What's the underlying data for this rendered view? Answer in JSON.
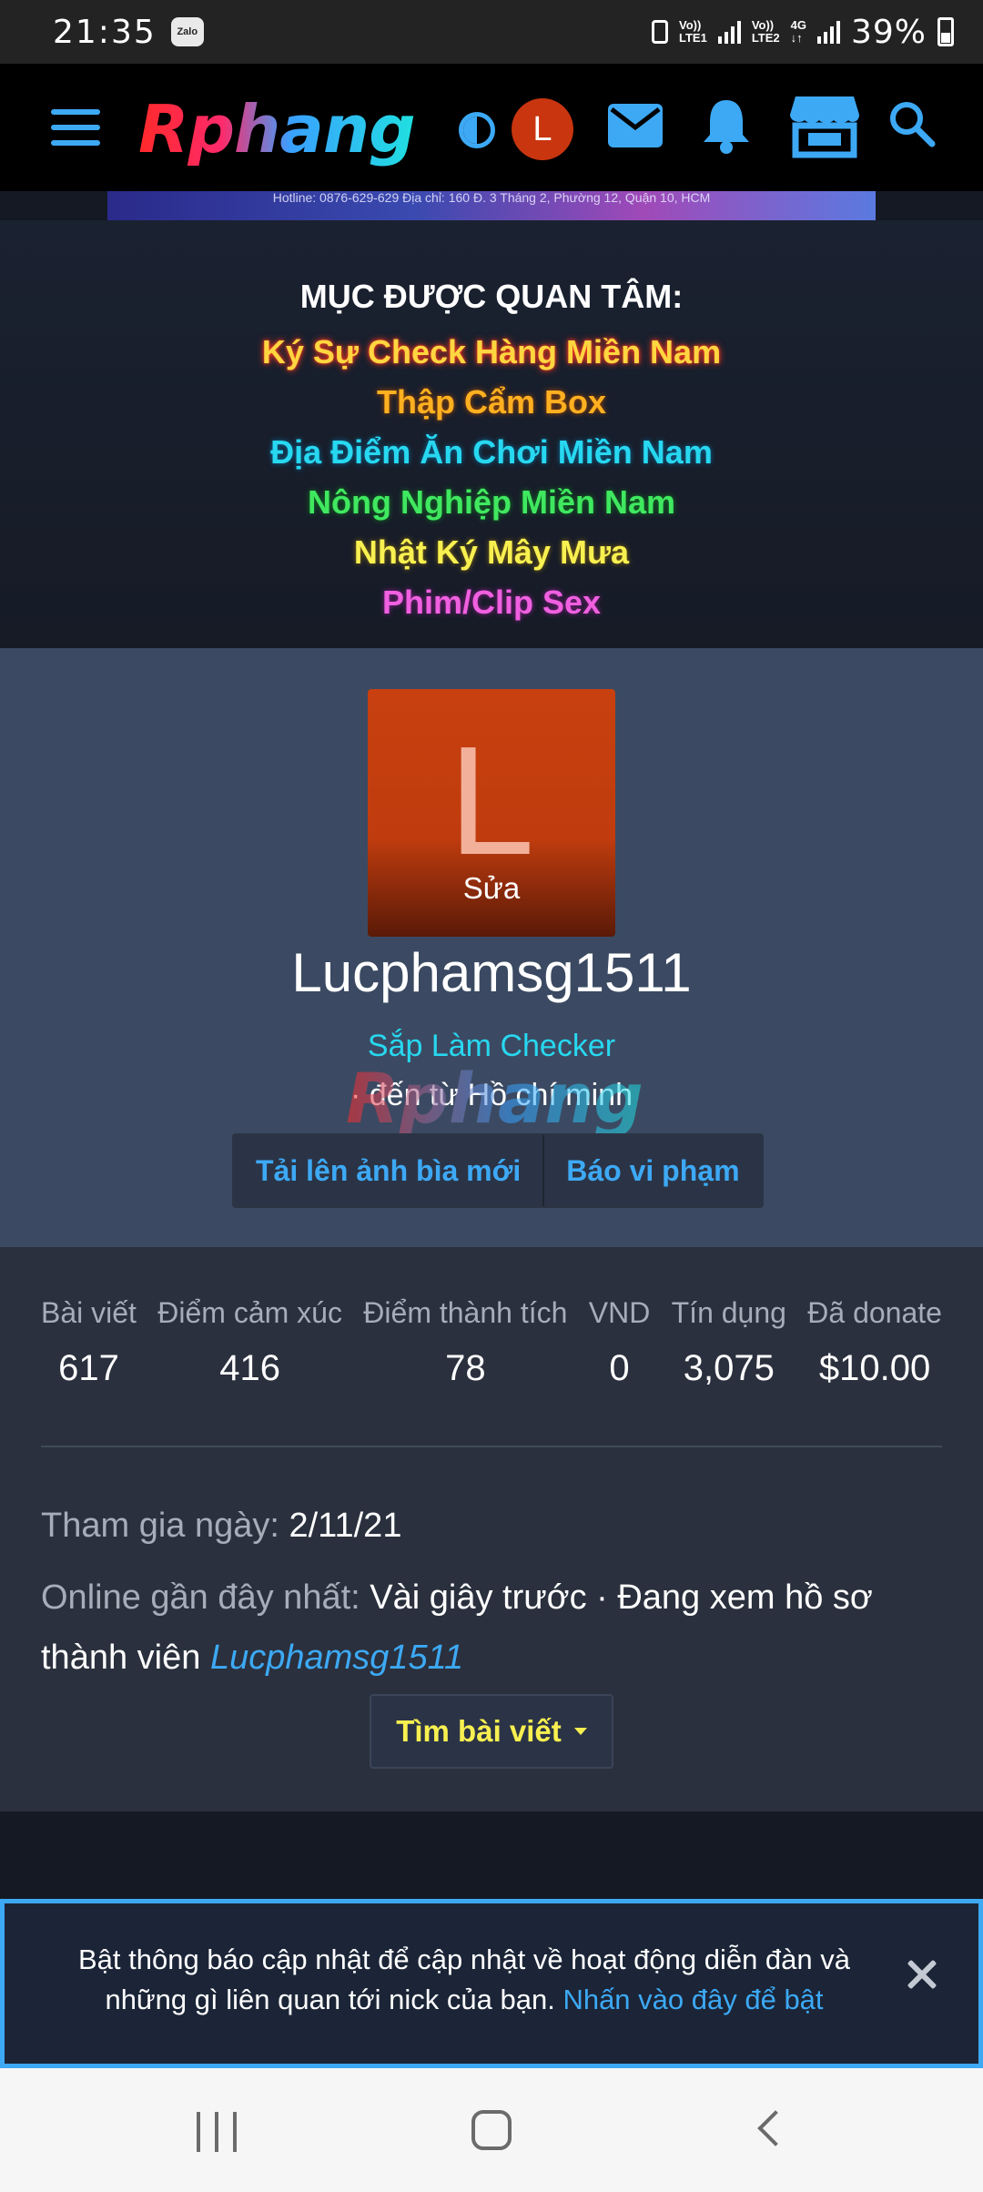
{
  "status_bar": {
    "time": "21:35",
    "app_badge": "Zalo",
    "sim1": [
      "Vo))",
      "LTE1"
    ],
    "sim2": [
      "Vo))",
      "LTE2"
    ],
    "net_type": "4G",
    "battery": "39%"
  },
  "header": {
    "logo": "Rphang",
    "avatar_letter": "L"
  },
  "banner": {
    "text": "Hotline: 0876-629-629     Địa chỉ: 160 Đ. 3 Tháng 2, Phường 12, Quận 10, HCM"
  },
  "interest": {
    "title": "MỤC ĐƯỢC QUAN TÂM:",
    "items": [
      "Ký Sự Check Hàng Miền Nam",
      "Thập Cẩm Box",
      "Địa Điểm Ăn Chơi Miền Nam",
      "Nông Nghiệp Miền Nam",
      "Nhật Ký Mây Mưa",
      "Phim/Clip Sex"
    ]
  },
  "profile": {
    "avatar_letter": "L",
    "avatar_edit": "Sửa",
    "username": "Lucphamsg1511",
    "title": "Sắp Làm Checker",
    "location": "· đến từ Hồ chí minh",
    "watermark": "Rphang",
    "buttons": {
      "upload_cover": "Tải lên ảnh bìa mới",
      "report": "Báo vi phạm"
    }
  },
  "stats": [
    {
      "label": "Bài viết",
      "value": "617"
    },
    {
      "label": "Điểm cảm xúc",
      "value": "416"
    },
    {
      "label": "Điểm thành tích",
      "value": "78"
    },
    {
      "label": "VND",
      "value": "0"
    },
    {
      "label": "Tín dụng",
      "value": "3,075"
    },
    {
      "label": "Đã donate",
      "value": "$10.00"
    }
  ],
  "info": {
    "join_label": "Tham gia ngày:",
    "join_value": "2/11/21",
    "online_label": "Online gần đây nhất:",
    "online_value": "Vài giây trước · Đang xem hồ sơ thành viên",
    "online_link": "Lucphamsg1511",
    "find_posts": "Tìm bài viết"
  },
  "notice": {
    "text": "Bật thông báo cập nhật để cập nhật về hoạt động diễn đàn và những gì liên quan tới nick của bạn.",
    "link": "Nhấn vào đây để bật"
  },
  "colors": {
    "accent": "#3da9f5",
    "avatar": "#c8350f",
    "profile_bg": "#3b4a62",
    "info_bg": "#2a303d",
    "highlight_yellow": "#f8f050",
    "title_cyan": "#27d8f0"
  }
}
